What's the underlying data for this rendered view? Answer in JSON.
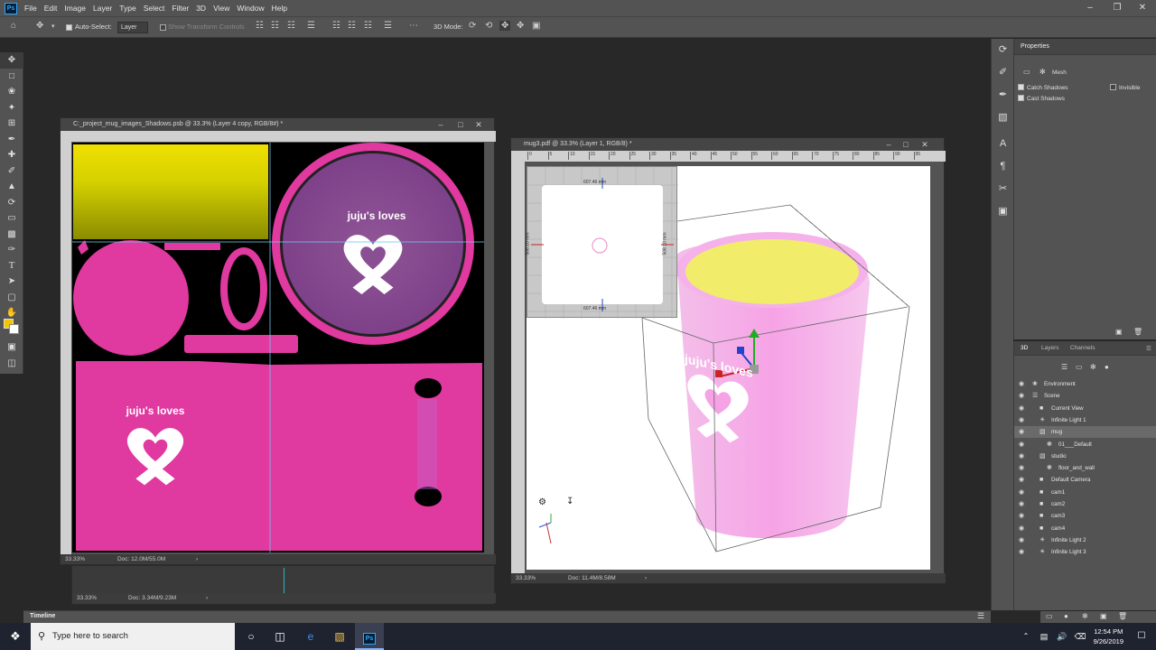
{
  "menubar": {
    "app_icon": "Ps",
    "items": [
      "File",
      "Edit",
      "Image",
      "Layer",
      "Type",
      "Select",
      "Filter",
      "3D",
      "View",
      "Window",
      "Help"
    ]
  },
  "options": {
    "auto_select_label": "Auto-Select:",
    "auto_select_value": "Layer",
    "show_transform": "Show Transform Controls",
    "mode_label": "3D Mode:"
  },
  "doc1": {
    "title": "C:_project_mug_images_Shadows.psb @ 33.3% (Layer 4 copy, RGB/8#) *",
    "zoom": "33.33%",
    "doc_size": "Doc: 12.0M/55.0M",
    "label_top": "juju's loves",
    "label_bottom": "juju's loves"
  },
  "doc1_bottom": {
    "zoom": "33.33%",
    "doc_size": "Doc: 3.34M/9.23M"
  },
  "doc2": {
    "title": "mug3.pdf @ 33.3% (Layer 1, RGB/8) *",
    "zoom": "33.33%",
    "doc_size": "Doc: 11.4M/8.58M",
    "ruler_ticks": [
      "0",
      "5",
      "10",
      "15",
      "20",
      "25",
      "30",
      "35",
      "40",
      "45",
      "50",
      "55",
      "60",
      "65",
      "70",
      "75",
      "80",
      "85",
      "90",
      "95"
    ],
    "inset_top_label": "607.46 mm",
    "inset_bottom_label": "607.46 mm",
    "inset_left_label": "508.10 mm",
    "inset_right_label": "508.10 mm",
    "mug_text": "juju's loves"
  },
  "properties": {
    "tab": "Properties",
    "mesh_label": "Mesh",
    "catch_shadows": "Catch Shadows",
    "cast_shadows": "Cast Shadows",
    "invisible": "Invisible"
  },
  "panel3d": {
    "tabs": [
      "3D",
      "Layers",
      "Channels"
    ],
    "rows": [
      {
        "label": "Environment",
        "icon": "environment-icon"
      },
      {
        "label": "Scene",
        "icon": "scene-icon"
      },
      {
        "label": "Current View",
        "icon": "camera-icon"
      },
      {
        "label": "Infinite Light 1",
        "icon": "light-icon"
      },
      {
        "label": "mug",
        "icon": "mesh-icon"
      },
      {
        "label": "01___Default",
        "icon": "material-icon"
      },
      {
        "label": "studio",
        "icon": "mesh-icon"
      },
      {
        "label": "floor_and_wall",
        "icon": "material-icon"
      },
      {
        "label": "Default Camera",
        "icon": "camera-icon"
      },
      {
        "label": "cam1",
        "icon": "camera-icon"
      },
      {
        "label": "cam2",
        "icon": "camera-icon"
      },
      {
        "label": "cam3",
        "icon": "camera-icon"
      },
      {
        "label": "cam4",
        "icon": "camera-icon"
      },
      {
        "label": "Infinite Light 2",
        "icon": "light-icon"
      },
      {
        "label": "Infinite Light 3",
        "icon": "light-icon"
      }
    ]
  },
  "timeline": {
    "label": "Timeline"
  },
  "taskbar": {
    "search_placeholder": "Type here to search",
    "time": "12:54 PM",
    "date": "9/26/2019"
  },
  "colors": {
    "pink": "#e0399f",
    "purple": "#8a4f93",
    "yellow": "#e5d700",
    "panel": "#535353"
  }
}
